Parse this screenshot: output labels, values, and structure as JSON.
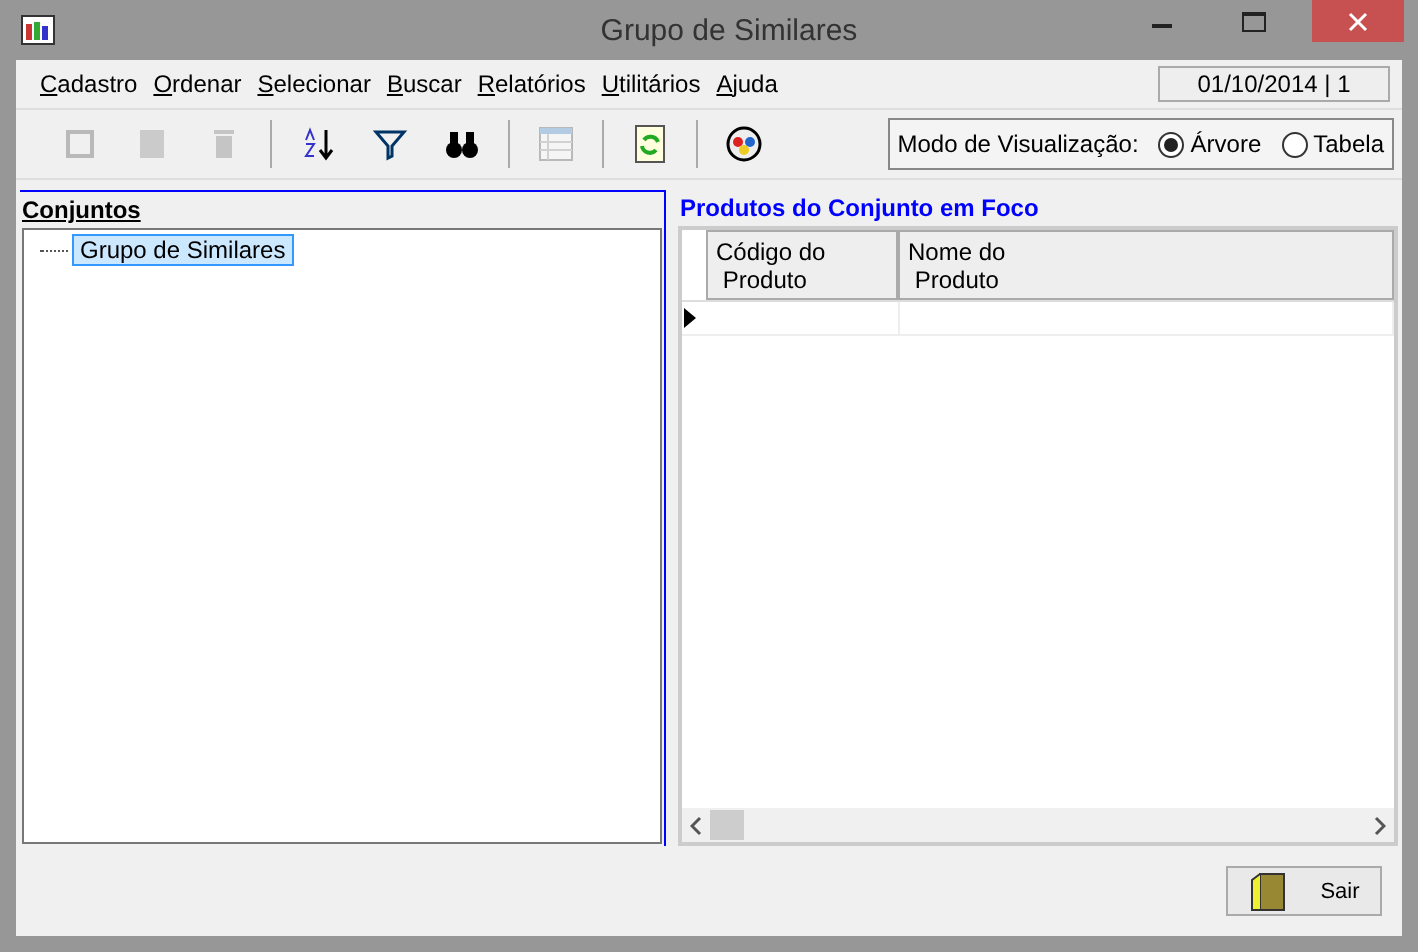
{
  "window": {
    "title": "Grupo de Similares"
  },
  "menu": [
    "Cadastro",
    "Ordenar",
    "Selecionar",
    "Buscar",
    "Relatórios",
    "Utilitários",
    "Ajuda"
  ],
  "date_badge": "01/10/2014 | 1",
  "toolbar": [
    {
      "kind": "new",
      "disabled": true
    },
    {
      "kind": "edit",
      "disabled": true
    },
    {
      "kind": "delete",
      "disabled": true
    },
    {
      "kind": "sep"
    },
    {
      "kind": "sort",
      "disabled": false
    },
    {
      "kind": "filter",
      "disabled": false
    },
    {
      "kind": "find",
      "disabled": false
    },
    {
      "kind": "sep"
    },
    {
      "kind": "table",
      "disabled": true
    },
    {
      "kind": "sep"
    },
    {
      "kind": "refresh",
      "disabled": false
    },
    {
      "kind": "sep"
    },
    {
      "kind": "palette",
      "disabled": false
    }
  ],
  "view_mode": {
    "label": "Modo de Visualização:",
    "options": [
      {
        "label": "Árvore",
        "selected": true
      },
      {
        "label": "Tabela",
        "selected": false
      }
    ]
  },
  "tree": {
    "title": "Conjuntos",
    "items": [
      {
        "label": "Grupo de Similares",
        "selected": true
      }
    ]
  },
  "grid": {
    "title": "Produtos do Conjunto em Foco",
    "columns": [
      {
        "line1": "Código do",
        "line2": "Produto"
      },
      {
        "line1": "Nome do",
        "line2": "Produto"
      }
    ]
  },
  "buttons": [
    {
      "label": "Sair"
    }
  ]
}
